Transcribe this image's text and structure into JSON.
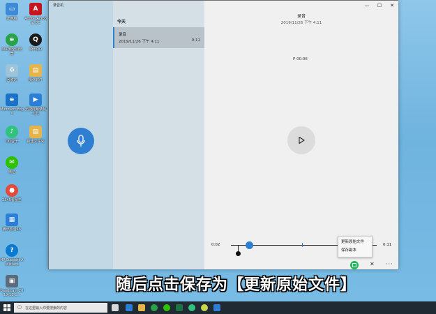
{
  "desktop_icons": [
    {
      "label": "此电脑",
      "icon": "computer-icon",
      "color": "#3d8ad8"
    },
    {
      "label": "Adobe Acrobat DC",
      "icon": "acrobat-icon",
      "color": "#c4161c"
    },
    {
      "label": "360安全浏览器",
      "icon": "browser-360-icon",
      "color": "#29a34a"
    },
    {
      "label": "腾讯QQ",
      "icon": "qq-icon",
      "color": "#1a1a1a"
    },
    {
      "label": "回收站",
      "icon": "recycle-bin-icon",
      "color": "#9cc3d8"
    },
    {
      "label": "操作软件",
      "icon": "folder-icon",
      "color": "#e5b54a"
    },
    {
      "label": "Microsoft Edge",
      "icon": "edge-icon",
      "color": "#1a73c9"
    },
    {
      "label": "迅捷屏幕录制工具",
      "icon": "screen-recorder-icon",
      "color": "#2b7fd6"
    },
    {
      "label": "QQ音乐",
      "icon": "qq-music-icon",
      "color": "#31c27c"
    },
    {
      "label": "新建文件夹",
      "icon": "new-folder-icon",
      "color": "#e5b54a"
    },
    {
      "label": "微信",
      "icon": "wechat-icon",
      "color": "#2dc100"
    },
    {
      "label": "2345看图王",
      "icon": "image-viewer-icon",
      "color": "#e24b3b"
    },
    {
      "label": "腾讯影音16",
      "icon": "video-player-icon",
      "color": "#2b7fd6"
    },
    {
      "label": "HP Support Assistant",
      "icon": "help-icon",
      "color": "#0a7ad1"
    },
    {
      "label": "bandicam 2019-11-2...",
      "icon": "video-file-icon",
      "color": "#5a6b7c"
    }
  ],
  "window": {
    "title": "录音机",
    "controls": {
      "minimize": "—",
      "maximize": "☐",
      "close": "✕"
    },
    "group_header": "今天",
    "recording": {
      "name": "录音",
      "date": "2019/11/26 下午 4:11",
      "duration": "0:11"
    },
    "detail": {
      "title": "录音",
      "date": "2019/11/26 下午 4:11",
      "marker": "P 00:06",
      "time_start": "0:02",
      "time_end": "0:11",
      "progress": 0.1
    },
    "context_menu": [
      "更新原始文件",
      "保存副本"
    ],
    "close_label": "✕",
    "more_label": "···"
  },
  "subtitle": "随后点击保存为【更新原始文件】",
  "taskbar": {
    "search_placeholder": "在这里输入你要搜索的内容"
  },
  "colors": {
    "accent": "#2e7fd1",
    "save_green": "#1db954"
  }
}
